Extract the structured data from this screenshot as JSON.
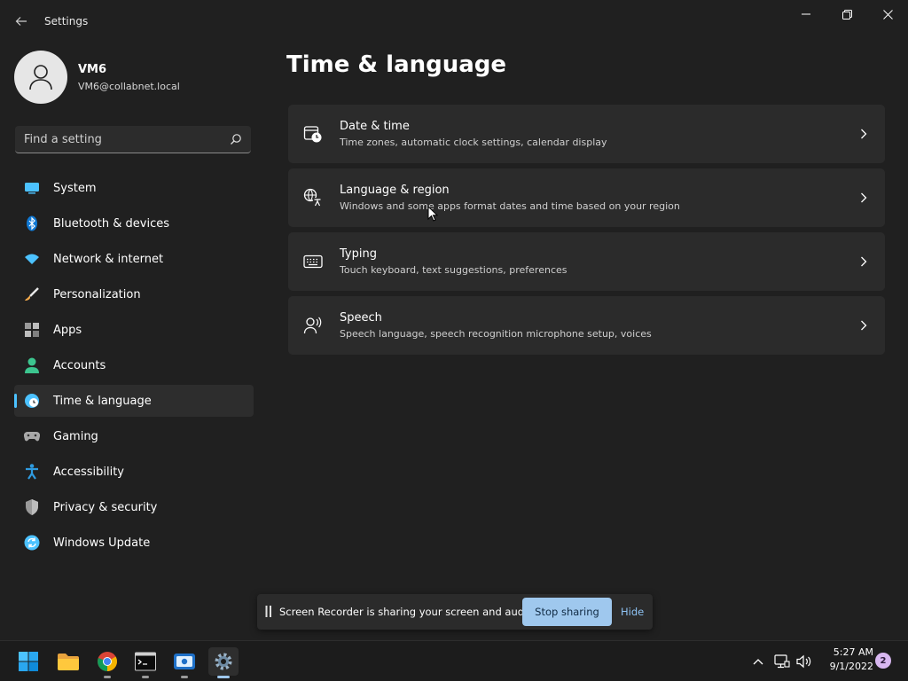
{
  "window": {
    "title": "Settings",
    "controls": [
      {
        "name": "minimize",
        "glyph": "—"
      },
      {
        "name": "restore",
        "glyph": "❐"
      },
      {
        "name": "close",
        "glyph": "✕"
      }
    ]
  },
  "profile": {
    "name": "VM6",
    "email": "VM6@collabnet.local"
  },
  "search": {
    "placeholder": "Find a setting",
    "value": ""
  },
  "sidebar": {
    "items": [
      {
        "label": "System",
        "icon": "monitor-icon",
        "color": "#4cc2ff"
      },
      {
        "label": "Bluetooth & devices",
        "icon": "bluetooth-icon",
        "color": "#0f78d4"
      },
      {
        "label": "Network & internet",
        "icon": "wifi-icon",
        "color": "#4cc2ff"
      },
      {
        "label": "Personalization",
        "icon": "brush-icon",
        "color": "#f2a94b"
      },
      {
        "label": "Apps",
        "icon": "apps-icon",
        "color": "#a8a8a8"
      },
      {
        "label": "Accounts",
        "icon": "account-icon",
        "color": "#3cc58f"
      },
      {
        "label": "Time & language",
        "icon": "globe-clock-icon",
        "color": "#4cc2ff",
        "selected": true
      },
      {
        "label": "Gaming",
        "icon": "gamepad-icon",
        "color": "#a8a8a8"
      },
      {
        "label": "Accessibility",
        "icon": "accessibility-icon",
        "color": "#2f9be0"
      },
      {
        "label": "Privacy & security",
        "icon": "shield-icon",
        "color": "#a8a8a8"
      },
      {
        "label": "Windows Update",
        "icon": "update-icon",
        "color": "#4cc2ff"
      }
    ]
  },
  "main": {
    "title": "Time & language",
    "cards": [
      {
        "title": "Date & time",
        "subtitle": "Time zones, automatic clock settings, calendar display",
        "icon": "calendar-clock-icon"
      },
      {
        "title": "Language & region",
        "subtitle": "Windows and some apps format dates and time based on your region",
        "icon": "language-icon"
      },
      {
        "title": "Typing",
        "subtitle": "Touch keyboard, text suggestions, preferences",
        "icon": "keyboard-icon"
      },
      {
        "title": "Speech",
        "subtitle": "Speech language, speech recognition microphone setup, voices",
        "icon": "speech-icon"
      }
    ]
  },
  "share_bar": {
    "message": "Screen Recorder is sharing your screen and audio.",
    "stop_label": "Stop sharing",
    "hide_label": "Hide"
  },
  "taskbar": {
    "apps": [
      "start-icon",
      "file-explorer-icon",
      "chrome-icon",
      "terminal-icon",
      "screen-recorder-icon",
      "settings-icon"
    ],
    "clock": {
      "time": "5:27 AM",
      "date": "9/1/2022"
    },
    "notifications": "2"
  },
  "colors": {
    "accent": "#4cc2ff",
    "background": "#202020",
    "card": "#2b2b2b",
    "stop_button": "#9fc8ee"
  }
}
